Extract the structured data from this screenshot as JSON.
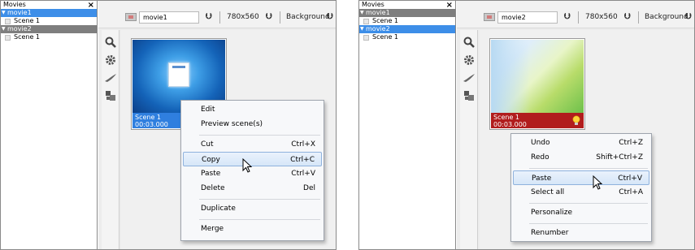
{
  "panels": [
    {
      "movies": {
        "title": "Movies",
        "close_glyph": "×",
        "tree": [
          {
            "label": "movie1",
            "kind": "movie",
            "state": "selected"
          },
          {
            "label": "Scene 1",
            "kind": "scene",
            "state": "normal"
          },
          {
            "label": "movie2",
            "kind": "movie",
            "state": "inactive"
          },
          {
            "label": "Scene 1",
            "kind": "scene",
            "state": "normal"
          }
        ]
      },
      "toolbar": {
        "movie_name": "movie1",
        "size": "780x560",
        "background": "Background"
      },
      "tools": [
        "search-icon",
        "gear-icon",
        "wing-icon",
        "puzzle-icon"
      ],
      "scene": {
        "name": "Scene 1",
        "duration": "00:03.000",
        "caption_color": "#2f7fdf"
      },
      "context_menu": {
        "items": [
          {
            "label": "Edit",
            "shortcut": ""
          },
          {
            "label": "Preview scene(s)",
            "shortcut": ""
          },
          {
            "label": "Cut",
            "shortcut": "Ctrl+X"
          },
          {
            "label": "Copy",
            "shortcut": "Ctrl+C",
            "highlighted": true
          },
          {
            "label": "Paste",
            "shortcut": "Ctrl+V"
          },
          {
            "label": "Delete",
            "shortcut": "Del"
          },
          {
            "label": "Duplicate",
            "shortcut": ""
          },
          {
            "label": "Merge",
            "shortcut": ""
          }
        ]
      }
    },
    {
      "movies": {
        "title": "Movies",
        "close_glyph": "×",
        "tree": [
          {
            "label": "movie1",
            "kind": "movie",
            "state": "inactive"
          },
          {
            "label": "Scene 1",
            "kind": "scene",
            "state": "normal"
          },
          {
            "label": "movie2",
            "kind": "movie",
            "state": "selected"
          },
          {
            "label": "Scene 1",
            "kind": "scene",
            "state": "normal"
          }
        ]
      },
      "toolbar": {
        "movie_name": "movie2",
        "size": "780x560",
        "background": "Background"
      },
      "tools": [
        "search-icon",
        "gear-icon",
        "wing-icon",
        "puzzle-icon"
      ],
      "scene": {
        "name": "Scene 1",
        "duration": "00:03.000",
        "caption_color": "#b11d1d"
      },
      "context_menu": {
        "items": [
          {
            "label": "Undo",
            "shortcut": "Ctrl+Z"
          },
          {
            "label": "Redo",
            "shortcut": "Shift+Ctrl+Z"
          },
          {
            "label": "Paste",
            "shortcut": "Ctrl+V",
            "highlighted": true
          },
          {
            "label": "Select all",
            "shortcut": "Ctrl+A"
          },
          {
            "label": "Personalize",
            "shortcut": ""
          },
          {
            "label": "Renumber",
            "shortcut": ""
          }
        ]
      }
    }
  ],
  "colors": {
    "selection_blue": "#3d8ee8",
    "inactive_gray": "#7e7e7e",
    "menu_highlight": "#d6e6f8"
  }
}
